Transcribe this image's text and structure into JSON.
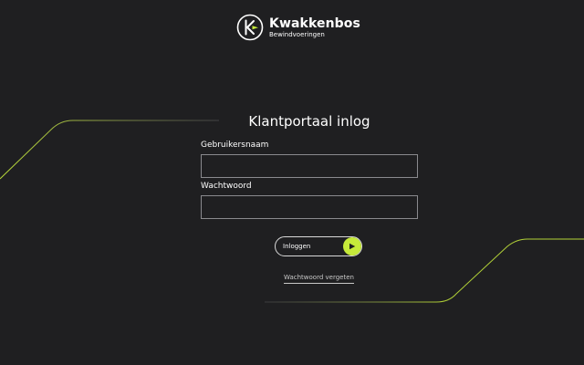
{
  "brand": {
    "name": "Kwakkenbos",
    "tagline": "Bewindvoeringen",
    "accent_color": "#c6ea3a",
    "mark_letter": "K"
  },
  "login": {
    "title": "Klantportaal inlog",
    "username_label": "Gebruikersnaam",
    "username_value": "",
    "password_label": "Wachtwoord",
    "password_value": "",
    "submit_label": "Inloggen",
    "submit_icon": "arrow-right-icon",
    "forgot_label": "Wachtwoord vergeten"
  },
  "colors": {
    "background": "#1f1f21",
    "line": "#c6ea3a",
    "field_border": "#8a8a8e"
  }
}
